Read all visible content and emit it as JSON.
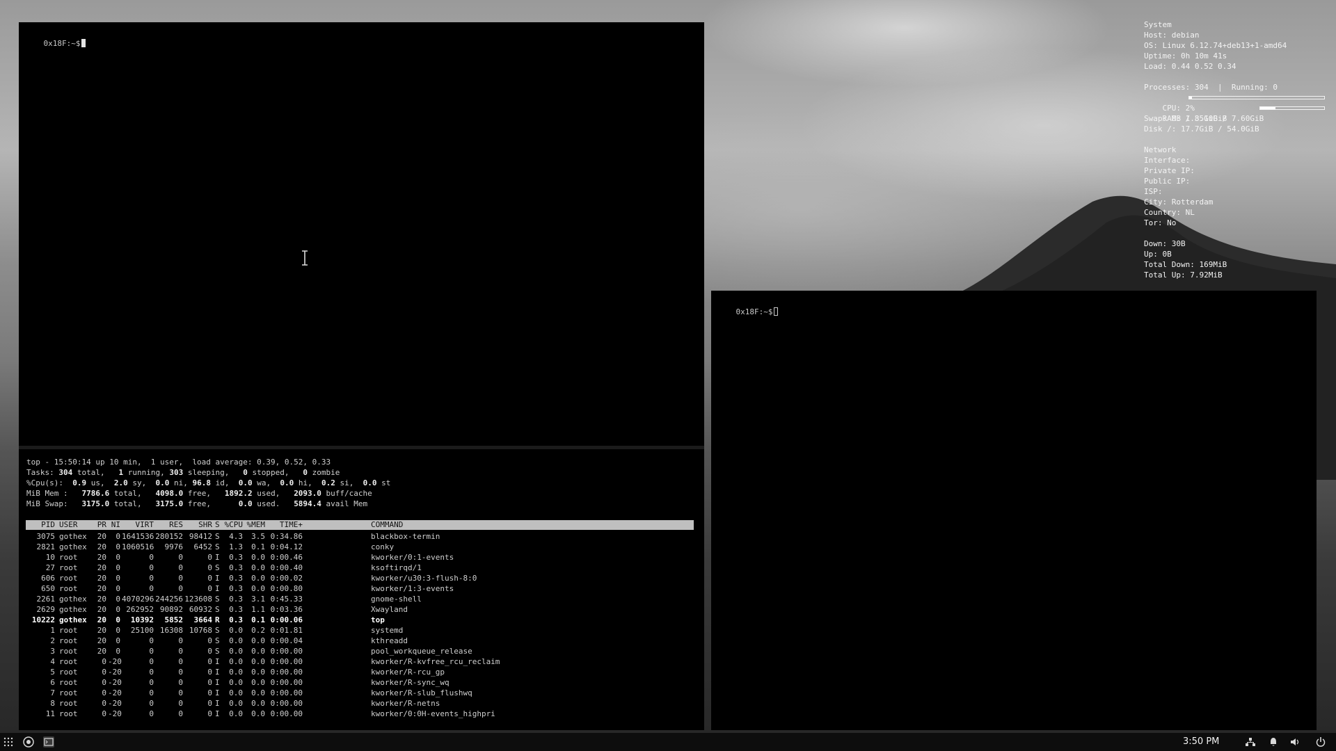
{
  "terminal_main": {
    "prompt": "0x18F:~$"
  },
  "terminal_right": {
    "prompt": "0x18F:~$"
  },
  "top": {
    "line1": "top - 15:50:14 up 10 min,  1 user,  load average: 0.39, 0.52, 0.33",
    "tasks": {
      "total": "304",
      "running": "1",
      "sleeping": "303",
      "stopped": "0",
      "zombie": "0"
    },
    "cpu": {
      "us": "0.9",
      "sy": "2.0",
      "ni": "0.0",
      "id": "96.8",
      "wa": "0.0",
      "hi": "0.0",
      "si": "0.2",
      "st": "0.0"
    },
    "mem": {
      "total": "7786.6",
      "free": "4098.0",
      "used": "1892.2",
      "buff_cache": "2093.0"
    },
    "swap": {
      "total": "3175.0",
      "free": "3175.0",
      "used": "0.0",
      "avail": "5894.4"
    },
    "columns": [
      "PID",
      "USER",
      "PR",
      "NI",
      "VIRT",
      "RES",
      "SHR",
      "S",
      "%CPU",
      "%MEM",
      "TIME+",
      "COMMAND"
    ],
    "processes": [
      [
        "3075",
        "gothex",
        "20",
        "0",
        "1641536",
        "280152",
        "98412",
        "S",
        "4.3",
        "3.5",
        "0:34.86",
        "blackbox-termin"
      ],
      [
        "2821",
        "gothex",
        "20",
        "0",
        "1060516",
        "9976",
        "6452",
        "S",
        "1.3",
        "0.1",
        "0:04.12",
        "conky"
      ],
      [
        "10",
        "root",
        "20",
        "0",
        "0",
        "0",
        "0",
        "I",
        "0.3",
        "0.0",
        "0:00.46",
        "kworker/0:1-events"
      ],
      [
        "27",
        "root",
        "20",
        "0",
        "0",
        "0",
        "0",
        "S",
        "0.3",
        "0.0",
        "0:00.40",
        "ksoftirqd/1"
      ],
      [
        "606",
        "root",
        "20",
        "0",
        "0",
        "0",
        "0",
        "I",
        "0.3",
        "0.0",
        "0:00.02",
        "kworker/u30:3-flush-8:0"
      ],
      [
        "650",
        "root",
        "20",
        "0",
        "0",
        "0",
        "0",
        "I",
        "0.3",
        "0.0",
        "0:00.80",
        "kworker/1:3-events"
      ],
      [
        "2261",
        "gothex",
        "20",
        "0",
        "4070296",
        "244256",
        "123608",
        "S",
        "0.3",
        "3.1",
        "0:45.33",
        "gnome-shell"
      ],
      [
        "2629",
        "gothex",
        "20",
        "0",
        "262952",
        "90892",
        "60932",
        "S",
        "0.3",
        "1.1",
        "0:03.36",
        "Xwayland"
      ],
      [
        "10222",
        "gothex",
        "20",
        "0",
        "10392",
        "5852",
        "3664",
        "R",
        "0.3",
        "0.1",
        "0:00.06",
        "top"
      ],
      [
        "1",
        "root",
        "20",
        "0",
        "25100",
        "16308",
        "10768",
        "S",
        "0.0",
        "0.2",
        "0:01.81",
        "systemd"
      ],
      [
        "2",
        "root",
        "20",
        "0",
        "0",
        "0",
        "0",
        "S",
        "0.0",
        "0.0",
        "0:00.04",
        "kthreadd"
      ],
      [
        "3",
        "root",
        "20",
        "0",
        "0",
        "0",
        "0",
        "S",
        "0.0",
        "0.0",
        "0:00.00",
        "pool_workqueue_release"
      ],
      [
        "4",
        "root",
        "0",
        "-20",
        "0",
        "0",
        "0",
        "I",
        "0.0",
        "0.0",
        "0:00.00",
        "kworker/R-kvfree_rcu_reclaim"
      ],
      [
        "5",
        "root",
        "0",
        "-20",
        "0",
        "0",
        "0",
        "I",
        "0.0",
        "0.0",
        "0:00.00",
        "kworker/R-rcu_gp"
      ],
      [
        "6",
        "root",
        "0",
        "-20",
        "0",
        "0",
        "0",
        "I",
        "0.0",
        "0.0",
        "0:00.00",
        "kworker/R-sync_wq"
      ],
      [
        "7",
        "root",
        "0",
        "-20",
        "0",
        "0",
        "0",
        "I",
        "0.0",
        "0.0",
        "0:00.00",
        "kworker/R-slub_flushwq"
      ],
      [
        "8",
        "root",
        "0",
        "-20",
        "0",
        "0",
        "0",
        "I",
        "0.0",
        "0.0",
        "0:00.00",
        "kworker/R-netns"
      ],
      [
        "11",
        "root",
        "0",
        "-20",
        "0",
        "0",
        "0",
        "I",
        "0.0",
        "0.0",
        "0:00.00",
        "kworker/0:0H-events_highpri"
      ]
    ],
    "highlighted_pid": "10222"
  },
  "conky": {
    "system_header": "System",
    "host": "Host: debian",
    "os": "OS: Linux 6.12.74+deb13+1-amd64",
    "uptime": "Uptime: 0h 10m 41s",
    "load": "Load: 0.44 0.52 0.34",
    "processes": "Processes: 304  |  Running: 0",
    "cpu": "CPU: 2%",
    "cpu_fraction": 0.02,
    "ram": "RAM: 1.85GiB / 7.60GiB",
    "ram_fraction": 0.24,
    "swap": "Swap: 0B / 3.10GiB",
    "disk": "Disk /: 17.7GiB / 54.0GiB",
    "network_header": "Network",
    "interface": "Interface: ",
    "private_ip": "Private IP: ",
    "public_ip": "Public IP: ",
    "isp": "ISP: ",
    "city": "City: Rotterdam",
    "country": "Country: NL",
    "tor": "Tor: No",
    "down": "Down: 30B",
    "up": "Up: 0B",
    "total_down": "Total Down: 169MiB",
    "total_up": "Total Up: 7.92MiB"
  },
  "taskbar": {
    "clock": "3:50 PM",
    "icons": [
      "apps-grid-icon",
      "chrome-icon",
      "terminal-icon",
      "network-icon",
      "notification-icon",
      "volume-icon",
      "power-icon"
    ]
  }
}
